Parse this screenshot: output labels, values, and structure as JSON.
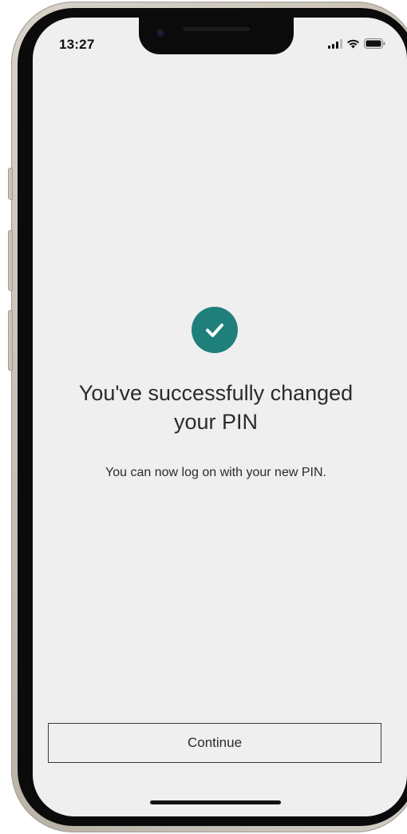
{
  "status_bar": {
    "time": "13:27",
    "icons": [
      "cellular-signal-icon",
      "wifi-icon",
      "battery-icon"
    ]
  },
  "success": {
    "icon": "checkmark-circle-icon",
    "accent_color": "#1f7f7a",
    "headline_line1": "You've successfully changed",
    "headline_line2": "your PIN",
    "message": "You can now log on with your new PIN."
  },
  "actions": {
    "continue_label": "Continue"
  }
}
